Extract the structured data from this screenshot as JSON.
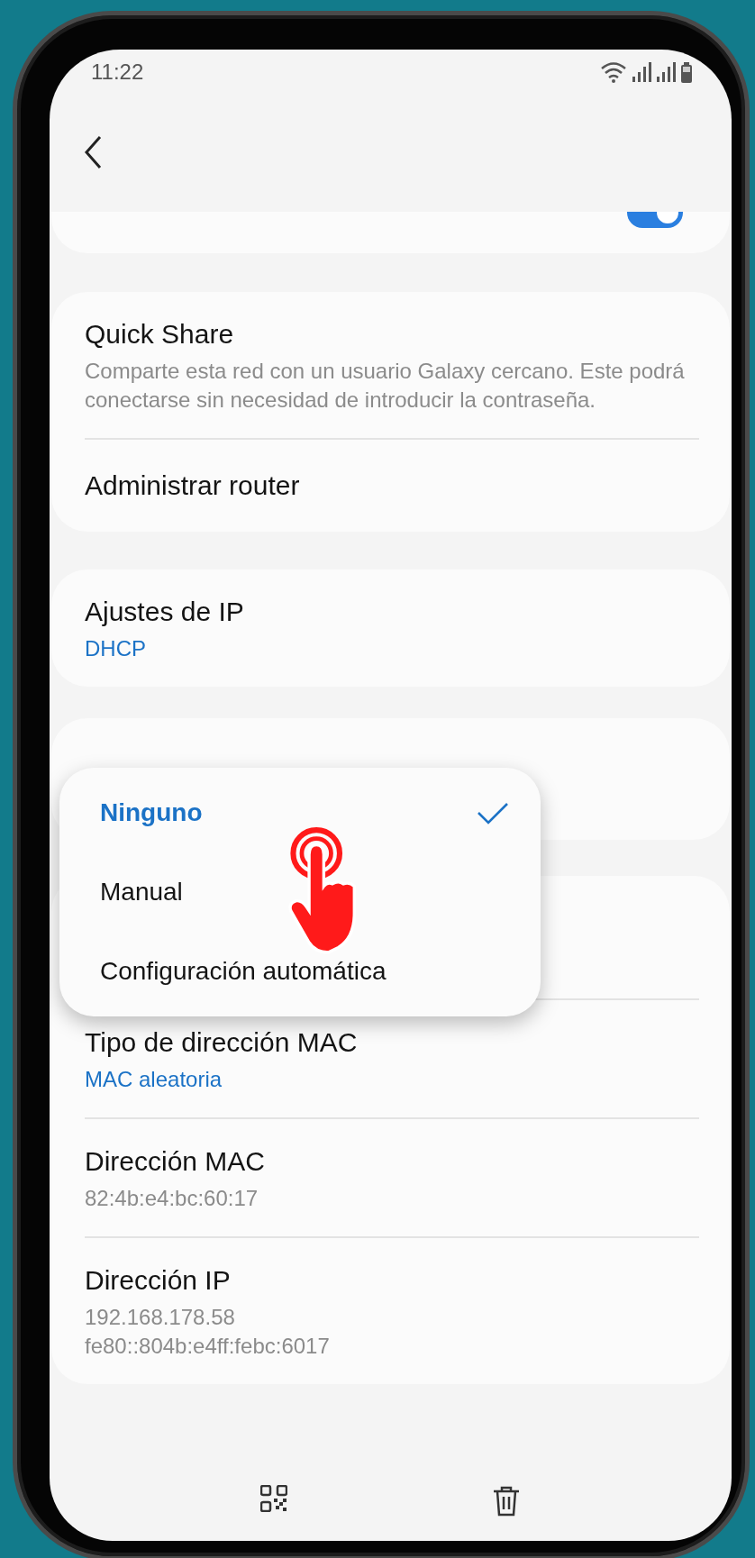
{
  "status_bar": {
    "time": "11:22"
  },
  "auto_reconnect": {
    "on": true
  },
  "cards": [
    {
      "items": [
        {
          "kind": "detail",
          "title": "Quick Share",
          "lines": [
            "Comparte esta red con un usuario Galaxy cercano. Este podrá conectarse sin necesidad de introducir la contraseña."
          ]
        },
        {
          "kind": "plain",
          "title": "Administrar router"
        }
      ]
    },
    {
      "items": [
        {
          "kind": "value",
          "title": "Ajustes de IP",
          "lines": [
            "DHCP"
          ]
        }
      ]
    },
    {
      "items": [
        {
          "kind": "value",
          "title": "Tipo de dirección MAC",
          "lines": [
            "MAC aleatoria"
          ]
        },
        {
          "kind": "detail",
          "title": "Dirección MAC",
          "lines": [
            "82:4b:e4:bc:60:17"
          ]
        },
        {
          "kind": "detail",
          "title": "Dirección IP",
          "lines": [
            "192.168.178.58",
            "fe80::804b:e4ff:febc:6017"
          ]
        }
      ]
    }
  ],
  "menu": {
    "options": [
      {
        "label": "Ninguno",
        "selected": true
      },
      {
        "label": "Manual",
        "selected": false
      },
      {
        "label": "Configuración automática",
        "selected": false
      }
    ]
  },
  "bottom_actions": [
    {
      "kind": "qr"
    },
    {
      "kind": "delete"
    }
  ]
}
